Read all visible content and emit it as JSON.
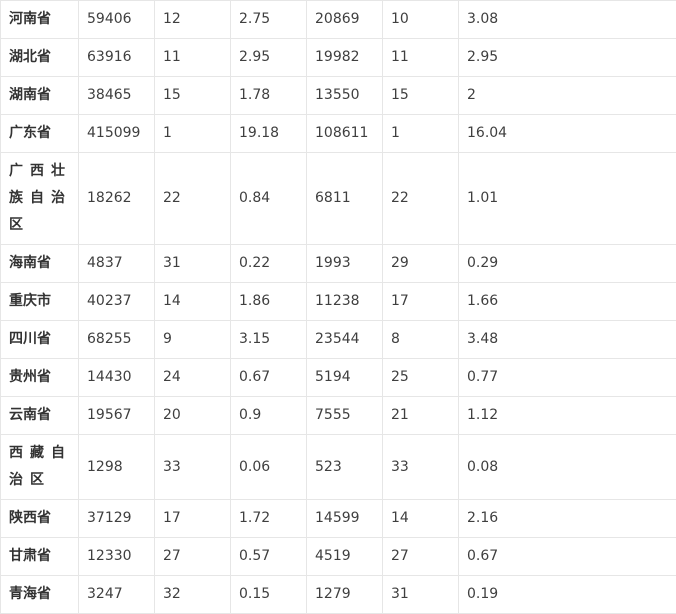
{
  "table": {
    "rows": [
      {
        "region": "河南省",
        "c1": "59406",
        "c2": "12",
        "c3": "2.75",
        "c4": "20869",
        "c5": "10",
        "c6": "3.08"
      },
      {
        "region": "湖北省",
        "c1": "63916",
        "c2": "11",
        "c3": "2.95",
        "c4": "19982",
        "c5": "11",
        "c6": "2.95"
      },
      {
        "region": "湖南省",
        "c1": "38465",
        "c2": "15",
        "c3": "1.78",
        "c4": "13550",
        "c5": "15",
        "c6": "2"
      },
      {
        "region": "广东省",
        "c1": "415099",
        "c2": "1",
        "c3": "19.18",
        "c4": "108611",
        "c5": "1",
        "c6": "16.04"
      },
      {
        "region": "广西壮族自治区",
        "c1": "18262",
        "c2": "22",
        "c3": "0.84",
        "c4": "6811",
        "c5": "22",
        "c6": "1.01"
      },
      {
        "region": "海南省",
        "c1": "4837",
        "c2": "31",
        "c3": "0.22",
        "c4": "1993",
        "c5": "29",
        "c6": "0.29"
      },
      {
        "region": "重庆市",
        "c1": "40237",
        "c2": "14",
        "c3": "1.86",
        "c4": "11238",
        "c5": "17",
        "c6": "1.66"
      },
      {
        "region": "四川省",
        "c1": "68255",
        "c2": "9",
        "c3": "3.15",
        "c4": "23544",
        "c5": "8",
        "c6": "3.48"
      },
      {
        "region": "贵州省",
        "c1": "14430",
        "c2": "24",
        "c3": "0.67",
        "c4": "5194",
        "c5": "25",
        "c6": "0.77"
      },
      {
        "region": "云南省",
        "c1": "19567",
        "c2": "20",
        "c3": "0.9",
        "c4": "7555",
        "c5": "21",
        "c6": "1.12"
      },
      {
        "region": "西藏自治区",
        "c1": "1298",
        "c2": "33",
        "c3": "0.06",
        "c4": "523",
        "c5": "33",
        "c6": "0.08"
      },
      {
        "region": "陕西省",
        "c1": "37129",
        "c2": "17",
        "c3": "1.72",
        "c4": "14599",
        "c5": "14",
        "c6": "2.16"
      },
      {
        "region": "甘肃省",
        "c1": "12330",
        "c2": "27",
        "c3": "0.57",
        "c4": "4519",
        "c5": "27",
        "c6": "0.67"
      },
      {
        "region": "青海省",
        "c1": "3247",
        "c2": "32",
        "c3": "0.15",
        "c4": "1279",
        "c5": "31",
        "c6": "0.19"
      }
    ]
  }
}
